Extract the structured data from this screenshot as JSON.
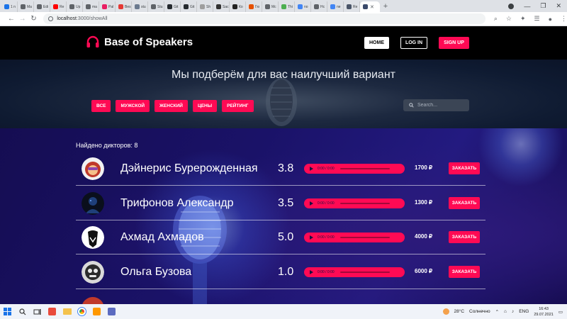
{
  "browser": {
    "tabs": [
      {
        "label": "1 n",
        "color": "#1a73e8"
      },
      {
        "label": "Ma",
        "color": "#5f6368"
      },
      {
        "label": "Edi",
        "color": "#5f6368"
      },
      {
        "label": "Re",
        "color": "#ff0000"
      },
      {
        "label": "Up",
        "color": "#5f6368"
      },
      {
        "label": "ma",
        "color": "#5f6368"
      },
      {
        "label": "Pal",
        "color": "#e91e63"
      },
      {
        "label": "Bes",
        "color": "#e53935"
      },
      {
        "label": "stu",
        "color": "#6b7a8f"
      },
      {
        "label": "Stu",
        "color": "#5f6368"
      },
      {
        "label": "Git",
        "color": "#24292e"
      },
      {
        "label": "Git",
        "color": "#24292e"
      },
      {
        "label": "Sh",
        "color": "#9e9e9e"
      },
      {
        "label": "Sac",
        "color": "#333333"
      },
      {
        "label": "Ко",
        "color": "#222222"
      },
      {
        "label": "Гю",
        "color": "#e65100"
      },
      {
        "label": "Mc",
        "color": "#5f6368"
      },
      {
        "label": "Thi",
        "color": "#4caf50"
      },
      {
        "label": "no",
        "color": "#4285f4"
      },
      {
        "label": "Hc",
        "color": "#5f6368"
      },
      {
        "label": "ne",
        "color": "#4285f4"
      },
      {
        "label": "Re",
        "color": "#4a5568"
      }
    ],
    "active_tab_icon": "page-icon",
    "new_tab_label": "+",
    "url_host": "localhost",
    "url_rest": ":3000/showAll"
  },
  "site": {
    "logo_text": "Base of Speakers",
    "nav": {
      "home": "HOME",
      "login": "LOG IN",
      "signup": "SIGN UP"
    },
    "hero_title": "Мы подберём для вас наилучший вариант",
    "filters": [
      "ВСЕ",
      "МУЖСКОЙ",
      "ЖЕНСКИЙ",
      "ЦЕНЫ",
      "РЕЙТИНГ"
    ],
    "search_placeholder": "Search...",
    "found_label": "Найдено дикторов: 8",
    "accent_color": "#ff0a54",
    "speakers": [
      {
        "name": "Дэйнерис Бурерожденная",
        "rating": "3.8",
        "time": "0:00 / 0:00",
        "price": "1700 ₽",
        "order": "ЗАКАЗАТЬ"
      },
      {
        "name": "Трифонов Александр",
        "rating": "3.5",
        "time": "0:00 / 0:00",
        "price": "1300 ₽",
        "order": "ЗАКАЗАТЬ"
      },
      {
        "name": "Ахмад Ахмадов",
        "rating": "5.0",
        "time": "0:00 / 0:00",
        "price": "4000 ₽",
        "order": "ЗАКАЗАТЬ"
      },
      {
        "name": "Ольга Бузова",
        "rating": "1.0",
        "time": "0:00 / 0:00",
        "price": "6000 ₽",
        "order": "ЗАКАЗАТЬ"
      }
    ]
  },
  "taskbar": {
    "temperature": "28°C",
    "weather": "Солнечно",
    "lang": "ENG",
    "time": "16:43",
    "date": "29.07.2021"
  }
}
